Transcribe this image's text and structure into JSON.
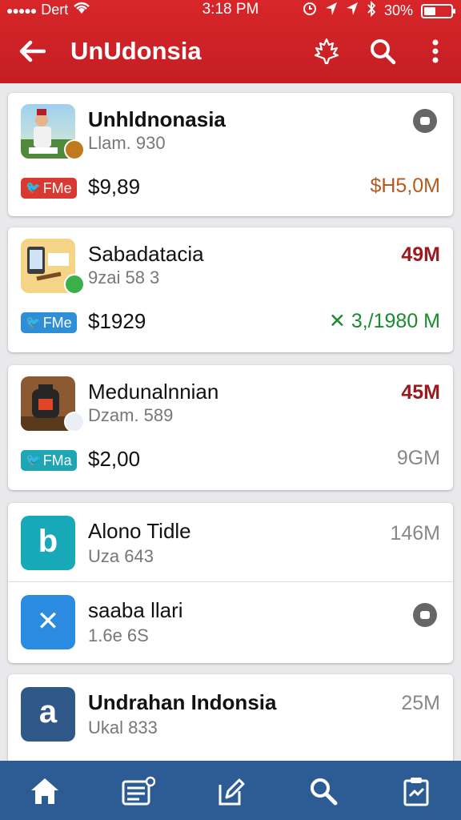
{
  "status_bar": {
    "carrier": "Dert",
    "time": "3:18 PM",
    "battery": "30%"
  },
  "app_bar": {
    "title": "UnUdonsia"
  },
  "apps": [
    {
      "name": "Unhldnonasia",
      "subtitle": "Llam. 930",
      "pill": "FMe",
      "pill_color": "#d83a31",
      "price": "$9,89",
      "size": "$H5,0M",
      "size_color": "#b35b1f",
      "icon": "person-illustration-icon",
      "action": "tag-icon"
    },
    {
      "name": "Sabadatacia",
      "subtitle": "9zai 58 3",
      "pill": "FMe",
      "pill_color": "#2f8fd6",
      "price": "$1929",
      "size": "49M",
      "size_color": "#9b1a1f",
      "secondary_value": "3,/1980 M",
      "secondary_color": "#1a8b2e",
      "icon": "tablet-illustration-icon"
    },
    {
      "name": "Medunalnnian",
      "subtitle": "Dzam. 589",
      "pill": "FMa",
      "pill_color": "#1fa6b5",
      "price": "$2,00",
      "size": "45M",
      "size_color": "#9b1a1f",
      "secondary_value": "9GM",
      "secondary_color": "#888888",
      "icon": "stove-illustration-icon"
    },
    {
      "name": "Alono Tidle",
      "subtitle": "Uza 643",
      "size": "146M",
      "size_color": "#888888",
      "icon_letter": "b",
      "icon_color": "#18a9b8"
    },
    {
      "name": "saaba llari",
      "subtitle": "1.6e 6S",
      "icon_letter": "✕",
      "icon_color": "#2a8be0",
      "action": "tag-icon"
    },
    {
      "name": "Undrahan Indonsia",
      "subtitle": "Ukal 833",
      "size": "25M",
      "size_color": "#888888",
      "icon_letter": "a",
      "icon_color": "#2f5787"
    }
  ],
  "bottom_nav": [
    "home-icon",
    "inbox-icon",
    "edit-icon",
    "search-icon",
    "clipboard-icon"
  ]
}
